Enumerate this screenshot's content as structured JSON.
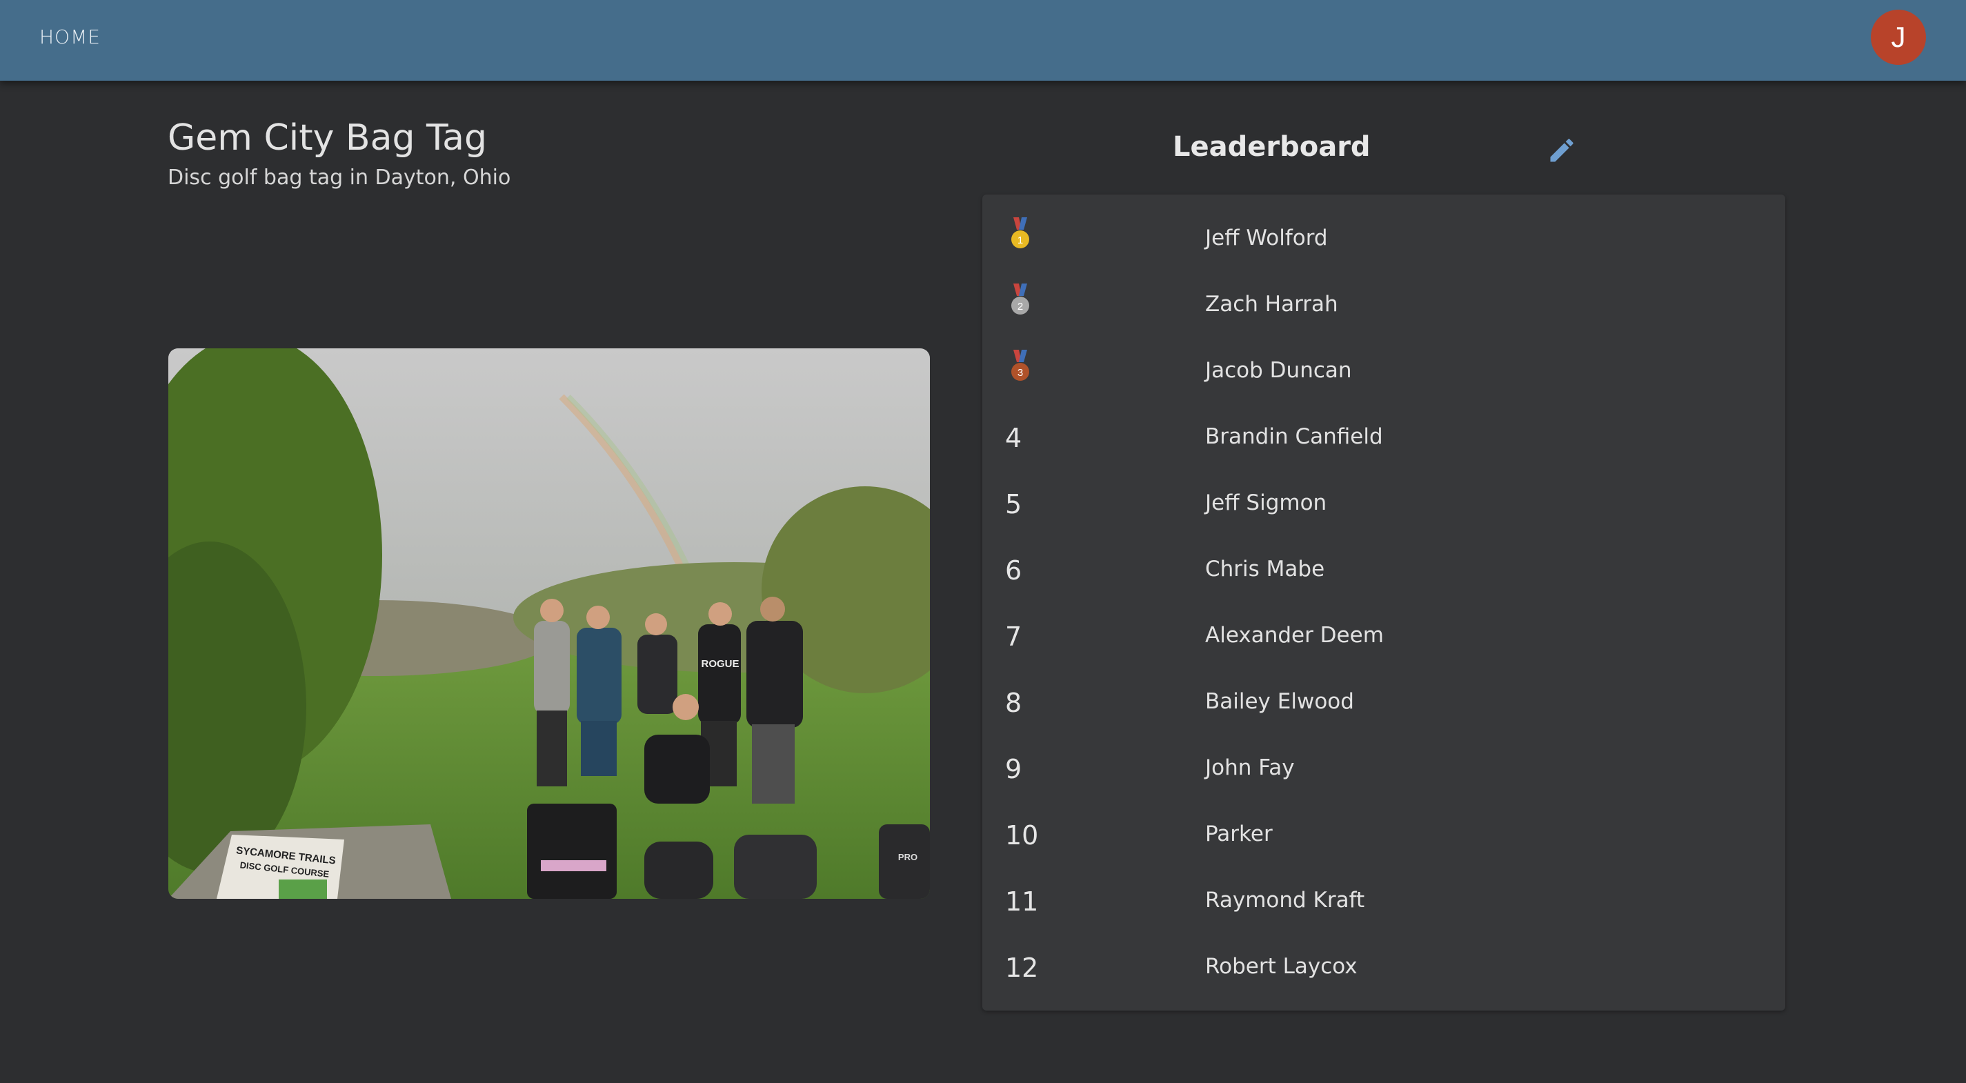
{
  "nav": {
    "home_label": "HOME",
    "avatar_initial": "J"
  },
  "page": {
    "title": "Gem City Bag Tag",
    "subtitle": "Disc golf bag tag in Dayton, Ohio",
    "photo": {
      "sign_line1": "SYCAMORE TRAILS",
      "sign_line2": "DISC GOLF COURSE",
      "shirt_text": "ROGUE",
      "bag_text": "PRO"
    }
  },
  "leaderboard": {
    "title": "Leaderboard",
    "edit_icon": "pencil-icon",
    "medal_colors": {
      "gold": "#e8b923",
      "silver": "#a8a8a8",
      "bronze": "#b0522a"
    },
    "entries": [
      {
        "rank": "1",
        "medal": "gold",
        "name": "Jeff Wolford"
      },
      {
        "rank": "2",
        "medal": "silver",
        "name": "Zach Harrah"
      },
      {
        "rank": "3",
        "medal": "bronze",
        "name": "Jacob Duncan"
      },
      {
        "rank": "4",
        "name": "Brandin Canfield"
      },
      {
        "rank": "5",
        "name": "Jeff Sigmon"
      },
      {
        "rank": "6",
        "name": "Chris Mabe"
      },
      {
        "rank": "7",
        "name": "Alexander Deem"
      },
      {
        "rank": "8",
        "name": "Bailey Elwood"
      },
      {
        "rank": "9",
        "name": "John Fay"
      },
      {
        "rank": "10",
        "name": "Parker"
      },
      {
        "rank": "11",
        "name": "Raymond Kraft"
      },
      {
        "rank": "12",
        "name": "Robert Laycox"
      }
    ]
  },
  "colors": {
    "appbar": "#456d8b",
    "background": "#2d2e30",
    "card": "#37383a",
    "accent": "#6f9fd0",
    "avatar": "#b8432a"
  }
}
